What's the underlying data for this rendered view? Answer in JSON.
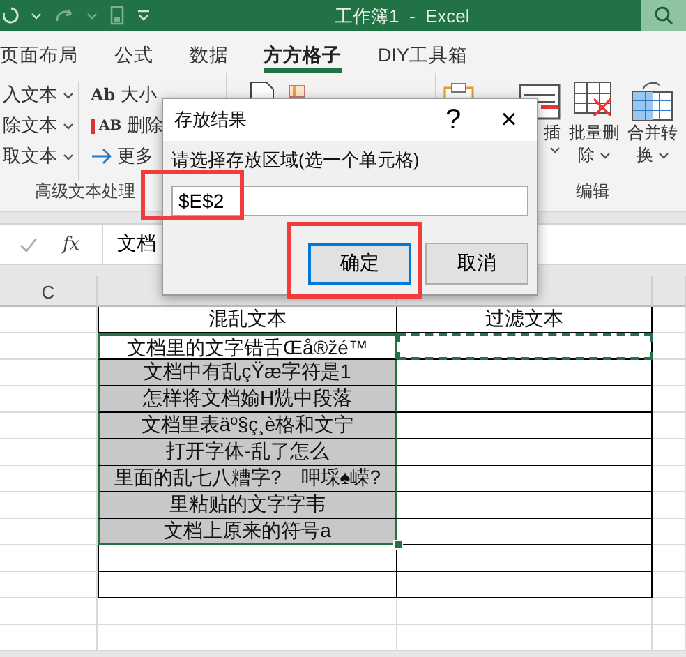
{
  "window": {
    "title": "工作簿1  -  Excel"
  },
  "tabs": [
    {
      "label": "页面布局",
      "selected": false
    },
    {
      "label": "公式",
      "selected": false
    },
    {
      "label": "数据",
      "selected": false
    },
    {
      "label": "方方格子",
      "selected": true
    },
    {
      "label": "DIY工具箱",
      "selected": false
    }
  ],
  "ribbon": {
    "text_group": {
      "label": "高级文本处理",
      "menus": [
        "入文本",
        "除文本",
        "取文本"
      ],
      "tools": [
        {
          "kind": "case",
          "icon": "Ab",
          "label": "大小"
        },
        {
          "kind": "delete",
          "icon": "AB",
          "label": "删除"
        },
        {
          "kind": "more",
          "label": "更多"
        }
      ]
    },
    "edit_group": {
      "label": "编辑",
      "buttons": [
        [
          "插"
        ],
        [
          "批量删",
          "除"
        ],
        [
          "合并转",
          "换"
        ]
      ]
    }
  },
  "formula_bar": {
    "fx": "fx",
    "value": "文档"
  },
  "sheet": {
    "column_headers": [
      "C"
    ],
    "header_row": {
      "d": "混乱文本",
      "e": "过滤文本"
    },
    "rows": [
      {
        "d": "文档里的文字错舌Œå®žé™",
        "shaded": false,
        "selected": true,
        "marquee": true
      },
      {
        "d": "文档中有乱çŸæ字符是1",
        "shaded": true,
        "selected": true,
        "marquee": false
      },
      {
        "d": "怎样将文档媮H兟中段落",
        "shaded": true,
        "selected": true,
        "marquee": false
      },
      {
        "d": "文档里表äº§ç¸è格和文宁",
        "shaded": true,
        "selected": true,
        "marquee": false
      },
      {
        "d": "打开字体-乱了怎么",
        "shaded": true,
        "selected": true,
        "marquee": false
      },
      {
        "d": "里面的乱七八糟字?　呷埰♠嵘?",
        "shaded": true,
        "selected": true,
        "marquee": false
      },
      {
        "d": "里粘贴的文字字韦",
        "shaded": true,
        "selected": true,
        "marquee": false
      },
      {
        "d": "文档上原来的符号a",
        "shaded": true,
        "selected": true,
        "marquee": false
      }
    ]
  },
  "dialog": {
    "title": "存放结果",
    "help": "?",
    "close": "×",
    "prompt": "请选择存放区域(选一个单元格)",
    "value": "$E$2",
    "field_highlighted": true,
    "buttons_highlighted": true,
    "buttons": [
      {
        "label": "确定",
        "default": true
      },
      {
        "label": "取消",
        "default": false
      }
    ]
  }
}
